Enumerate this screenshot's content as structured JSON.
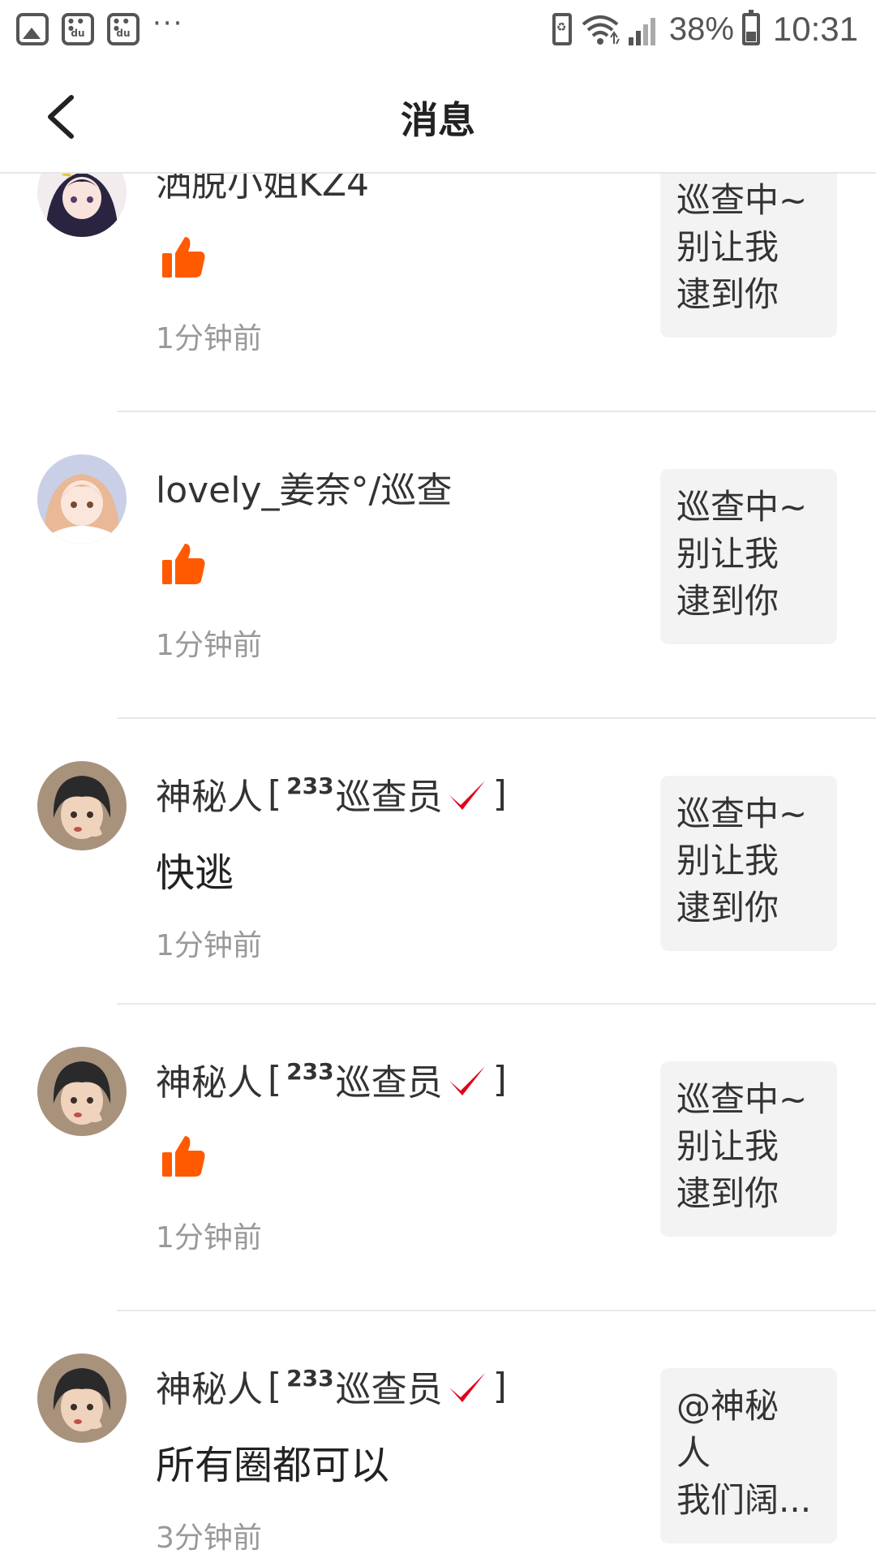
{
  "status_bar": {
    "battery_percent": "38%",
    "time": "10:31",
    "notification_icons": [
      "gallery-icon",
      "baidu-paw-icon",
      "baidu-paw-icon"
    ],
    "more": "···",
    "paw_text": "du"
  },
  "header": {
    "title": "消息"
  },
  "messages": [
    {
      "username": "洒脱小姐KZ4",
      "content": "",
      "type": "like",
      "time": "1分钟前",
      "preview": [
        "巡查中~",
        "别让我",
        "逮到你"
      ]
    },
    {
      "username": "lovely_姜奈°/巡查",
      "content": "",
      "type": "like",
      "time": "1分钟前",
      "preview": [
        "巡查中~",
        "别让我",
        "逮到你"
      ]
    },
    {
      "username": "神秘人",
      "badge_number": "233",
      "badge_text": "巡查员",
      "content": "快逃",
      "type": "comment",
      "time": "1分钟前",
      "preview": [
        "巡查中~",
        "别让我",
        "逮到你"
      ]
    },
    {
      "username": "神秘人",
      "badge_number": "233",
      "badge_text": "巡查员",
      "content": "",
      "type": "like",
      "time": "1分钟前",
      "preview": [
        "巡查中~",
        "别让我",
        "逮到你"
      ]
    },
    {
      "username": "神秘人",
      "badge_number": "233",
      "badge_text": "巡查员",
      "content": "所有圈都可以",
      "type": "comment",
      "time": "3分钟前",
      "preview": [
        "@神秘",
        "人",
        "我们阔..."
      ]
    }
  ],
  "colors": {
    "like_orange": "#ff5a00",
    "check_red": "#e0001b",
    "time_gray": "#999999",
    "preview_bg": "#f3f3f3",
    "divider": "#e8e8e8"
  },
  "icons": {
    "back": "chevron-left-icon",
    "like": "thumbs-up-icon",
    "verified": "check-mark-icon"
  }
}
